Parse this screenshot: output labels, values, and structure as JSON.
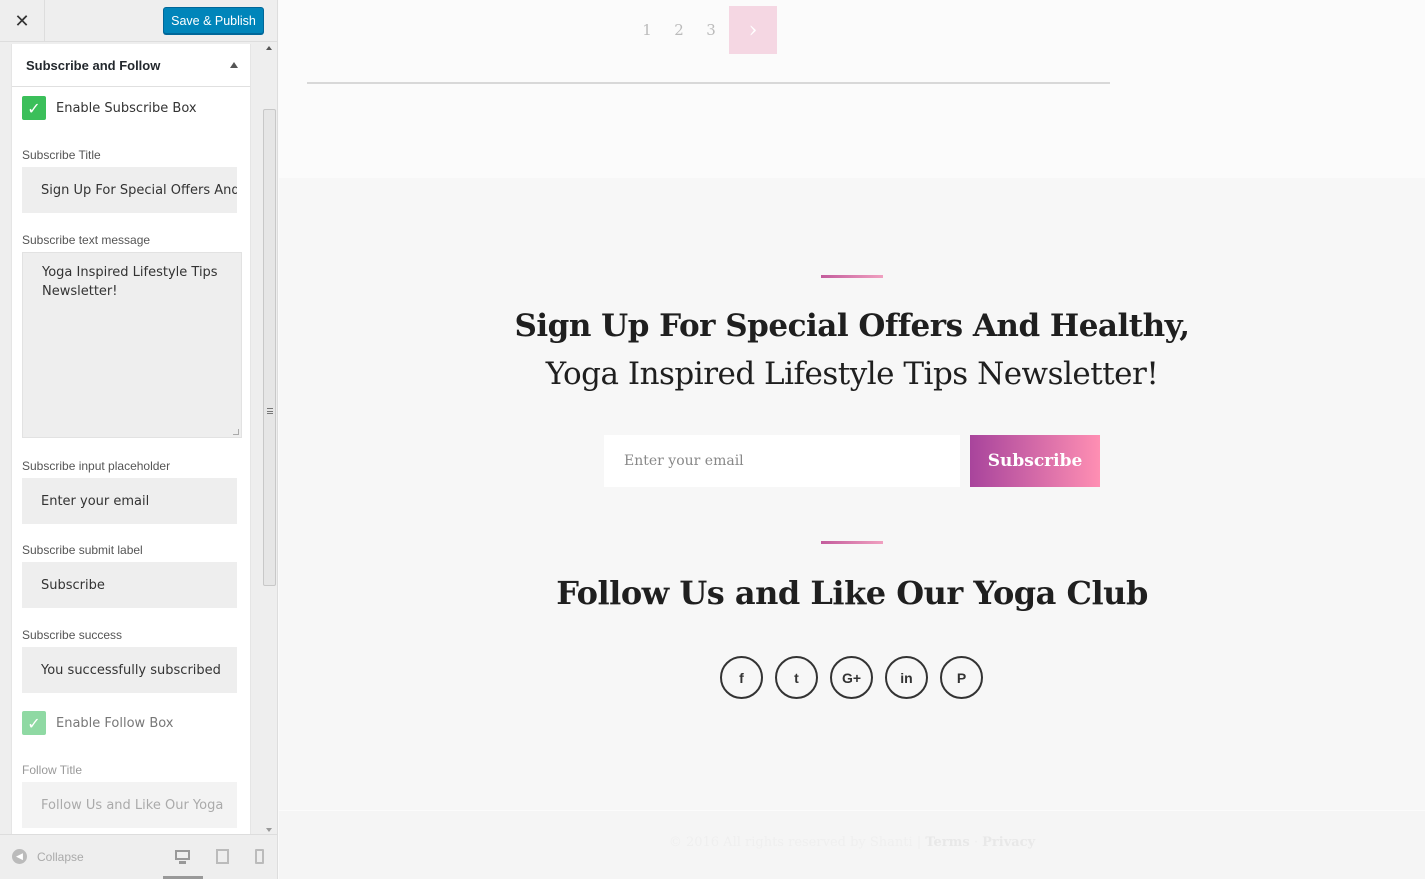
{
  "header": {
    "close_icon": "close-icon",
    "save_label": "Save & Publish",
    "save_color": "#0085ba"
  },
  "section": {
    "title": "Subscribe and Follow"
  },
  "fields": {
    "enable_subscribe": {
      "label": "Enable Subscribe Box",
      "checked": true
    },
    "subscribe_title": {
      "label": "Subscribe Title",
      "value": "Sign Up For Special Offers And Healthy,"
    },
    "subscribe_text": {
      "label": "Subscribe text message",
      "value": "Yoga Inspired Lifestyle Tips Newsletter!"
    },
    "subscribe_placeholder": {
      "label": "Subscribe input placeholder",
      "value": "Enter your email"
    },
    "subscribe_submit": {
      "label": "Subscribe submit label",
      "value": "Subscribe"
    },
    "subscribe_success": {
      "label": "Subscribe success",
      "value": "You successfully subscribed"
    },
    "enable_follow": {
      "label": "Enable Follow Box",
      "checked": true
    },
    "follow_title": {
      "label": "Follow Title",
      "value": "Follow Us and Like Our Yoga"
    }
  },
  "footer_controls": {
    "collapse_label": "Collapse",
    "devices": [
      "desktop",
      "tablet",
      "mobile"
    ],
    "active_device": "desktop"
  },
  "preview": {
    "pagination": {
      "pages": [
        "1",
        "2",
        "3"
      ],
      "next_icon": "›"
    },
    "subscribe": {
      "title": "Sign Up For Special Offers And Healthy,",
      "text": "Yoga Inspired Lifestyle Tips Newsletter!",
      "placeholder": "Enter your email",
      "button": "Subscribe",
      "button_gradient": [
        "#a8449c",
        "#ff8fb3"
      ]
    },
    "follow": {
      "title": "Follow Us and Like Our Yoga Club",
      "socials": [
        {
          "name": "facebook",
          "glyph": "f"
        },
        {
          "name": "twitter",
          "glyph": "t"
        },
        {
          "name": "google-plus",
          "glyph": "G+"
        },
        {
          "name": "linkedin",
          "glyph": "in"
        },
        {
          "name": "pinterest",
          "glyph": "P"
        }
      ]
    },
    "footer": {
      "copyright": "© 2016 All rights reserved by Shanti |",
      "terms": "Terms",
      "separator": "·",
      "privacy": "Privacy"
    }
  }
}
